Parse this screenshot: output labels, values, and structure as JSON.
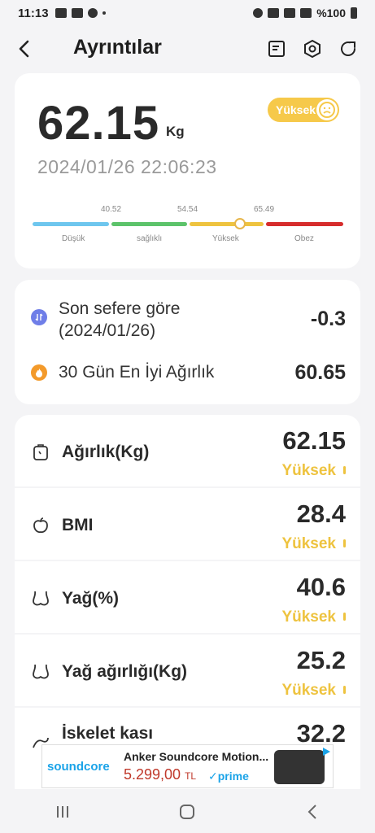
{
  "status_bar": {
    "time": "11:13",
    "battery": "%100"
  },
  "header": {
    "title": "Ayrıntılar"
  },
  "weight_card": {
    "value": "62.15",
    "unit": "Kg",
    "badge": "Yüksek",
    "datetime": "2024/01/26 22:06:23",
    "scale": {
      "ticks": [
        "40.52",
        "54.54",
        "65.49"
      ],
      "categories": [
        "Düşük",
        "sağlıklı",
        "Yüksek",
        "Obez"
      ],
      "colors": [
        "#6ec6ee",
        "#5cc36a",
        "#eec33f",
        "#d62c2c"
      ]
    }
  },
  "comparison": {
    "last": {
      "label_line1": "Son sefere göre",
      "label_line2": "(2024/01/26)",
      "value": "-0.3"
    },
    "best": {
      "label": "30 Gün En İyi Ağırlık",
      "value": "60.65"
    }
  },
  "metrics": [
    {
      "label": "Ağırlık(Kg)",
      "value": "62.15",
      "status": "Yüksek",
      "icon": "scale-icon"
    },
    {
      "label": "BMI",
      "value": "28.4",
      "status": "Yüksek",
      "icon": "apple-icon"
    },
    {
      "label": "Yağ(%)",
      "value": "40.6",
      "status": "Yüksek",
      "icon": "body-icon"
    },
    {
      "label": "Yağ ağırlığı(Kg)",
      "value": "25.2",
      "status": "Yüksek",
      "icon": "body-icon"
    },
    {
      "label": "İskelet kası",
      "value": "32.2",
      "status": "",
      "icon": "muscle-icon"
    }
  ],
  "ad": {
    "brand": "soundcore",
    "title": "Anker Soundcore Motion...",
    "price": "5.299,00",
    "currency": "TL",
    "prime": "✓prime"
  },
  "accent": "#eec33f"
}
